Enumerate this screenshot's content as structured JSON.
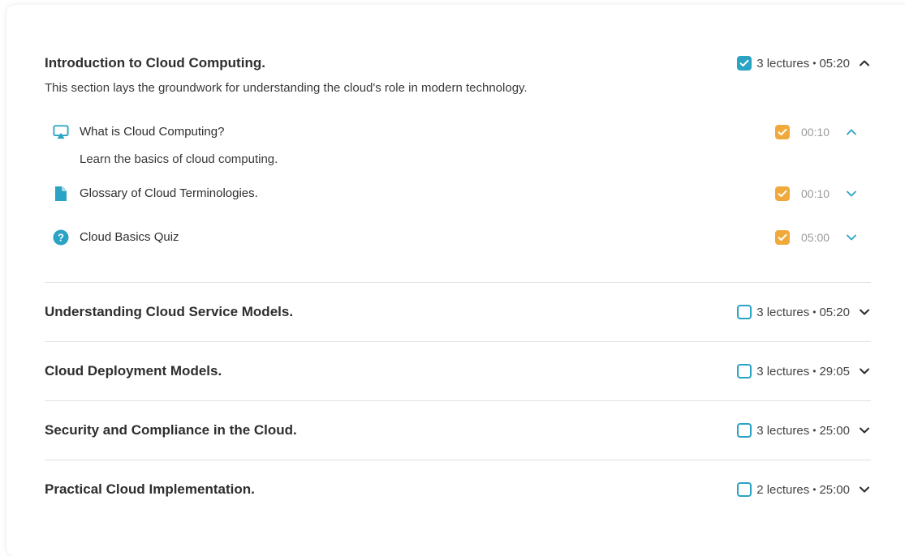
{
  "sections": [
    {
      "title": "Introduction to Cloud Computing.",
      "description": "This section lays the groundwork for understanding the cloud's role in modern technology.",
      "completed": true,
      "lectures_count": "3 lectures",
      "duration": "05:20",
      "expanded": true,
      "lectures": [
        {
          "icon": "presentation-icon",
          "title": "What is Cloud Computing?",
          "description": "Learn the basics of cloud computing.",
          "completed": true,
          "duration": "00:10",
          "expanded": true
        },
        {
          "icon": "document-icon",
          "title": "Glossary of Cloud Terminologies.",
          "completed": true,
          "duration": "00:10",
          "expanded": false
        },
        {
          "icon": "question-icon",
          "title": "Cloud Basics Quiz",
          "completed": true,
          "duration": "05:00",
          "expanded": false
        }
      ]
    },
    {
      "title": "Understanding Cloud Service Models.",
      "completed": false,
      "lectures_count": "3 lectures",
      "duration": "05:20",
      "expanded": false
    },
    {
      "title": "Cloud Deployment Models.",
      "completed": false,
      "lectures_count": "3 lectures",
      "duration": "29:05",
      "expanded": false
    },
    {
      "title": "Security and Compliance in the Cloud.",
      "completed": false,
      "lectures_count": "3 lectures",
      "duration": "25:00",
      "expanded": false
    },
    {
      "title": "Practical Cloud Implementation.",
      "completed": false,
      "lectures_count": "2 lectures",
      "duration": "25:00",
      "expanded": false
    }
  ],
  "separator": "•",
  "colors": {
    "teal": "#2aa3c4",
    "orange": "#f0a93b",
    "divider": "#e2e2e2",
    "muted_text": "#9a9a9a"
  }
}
